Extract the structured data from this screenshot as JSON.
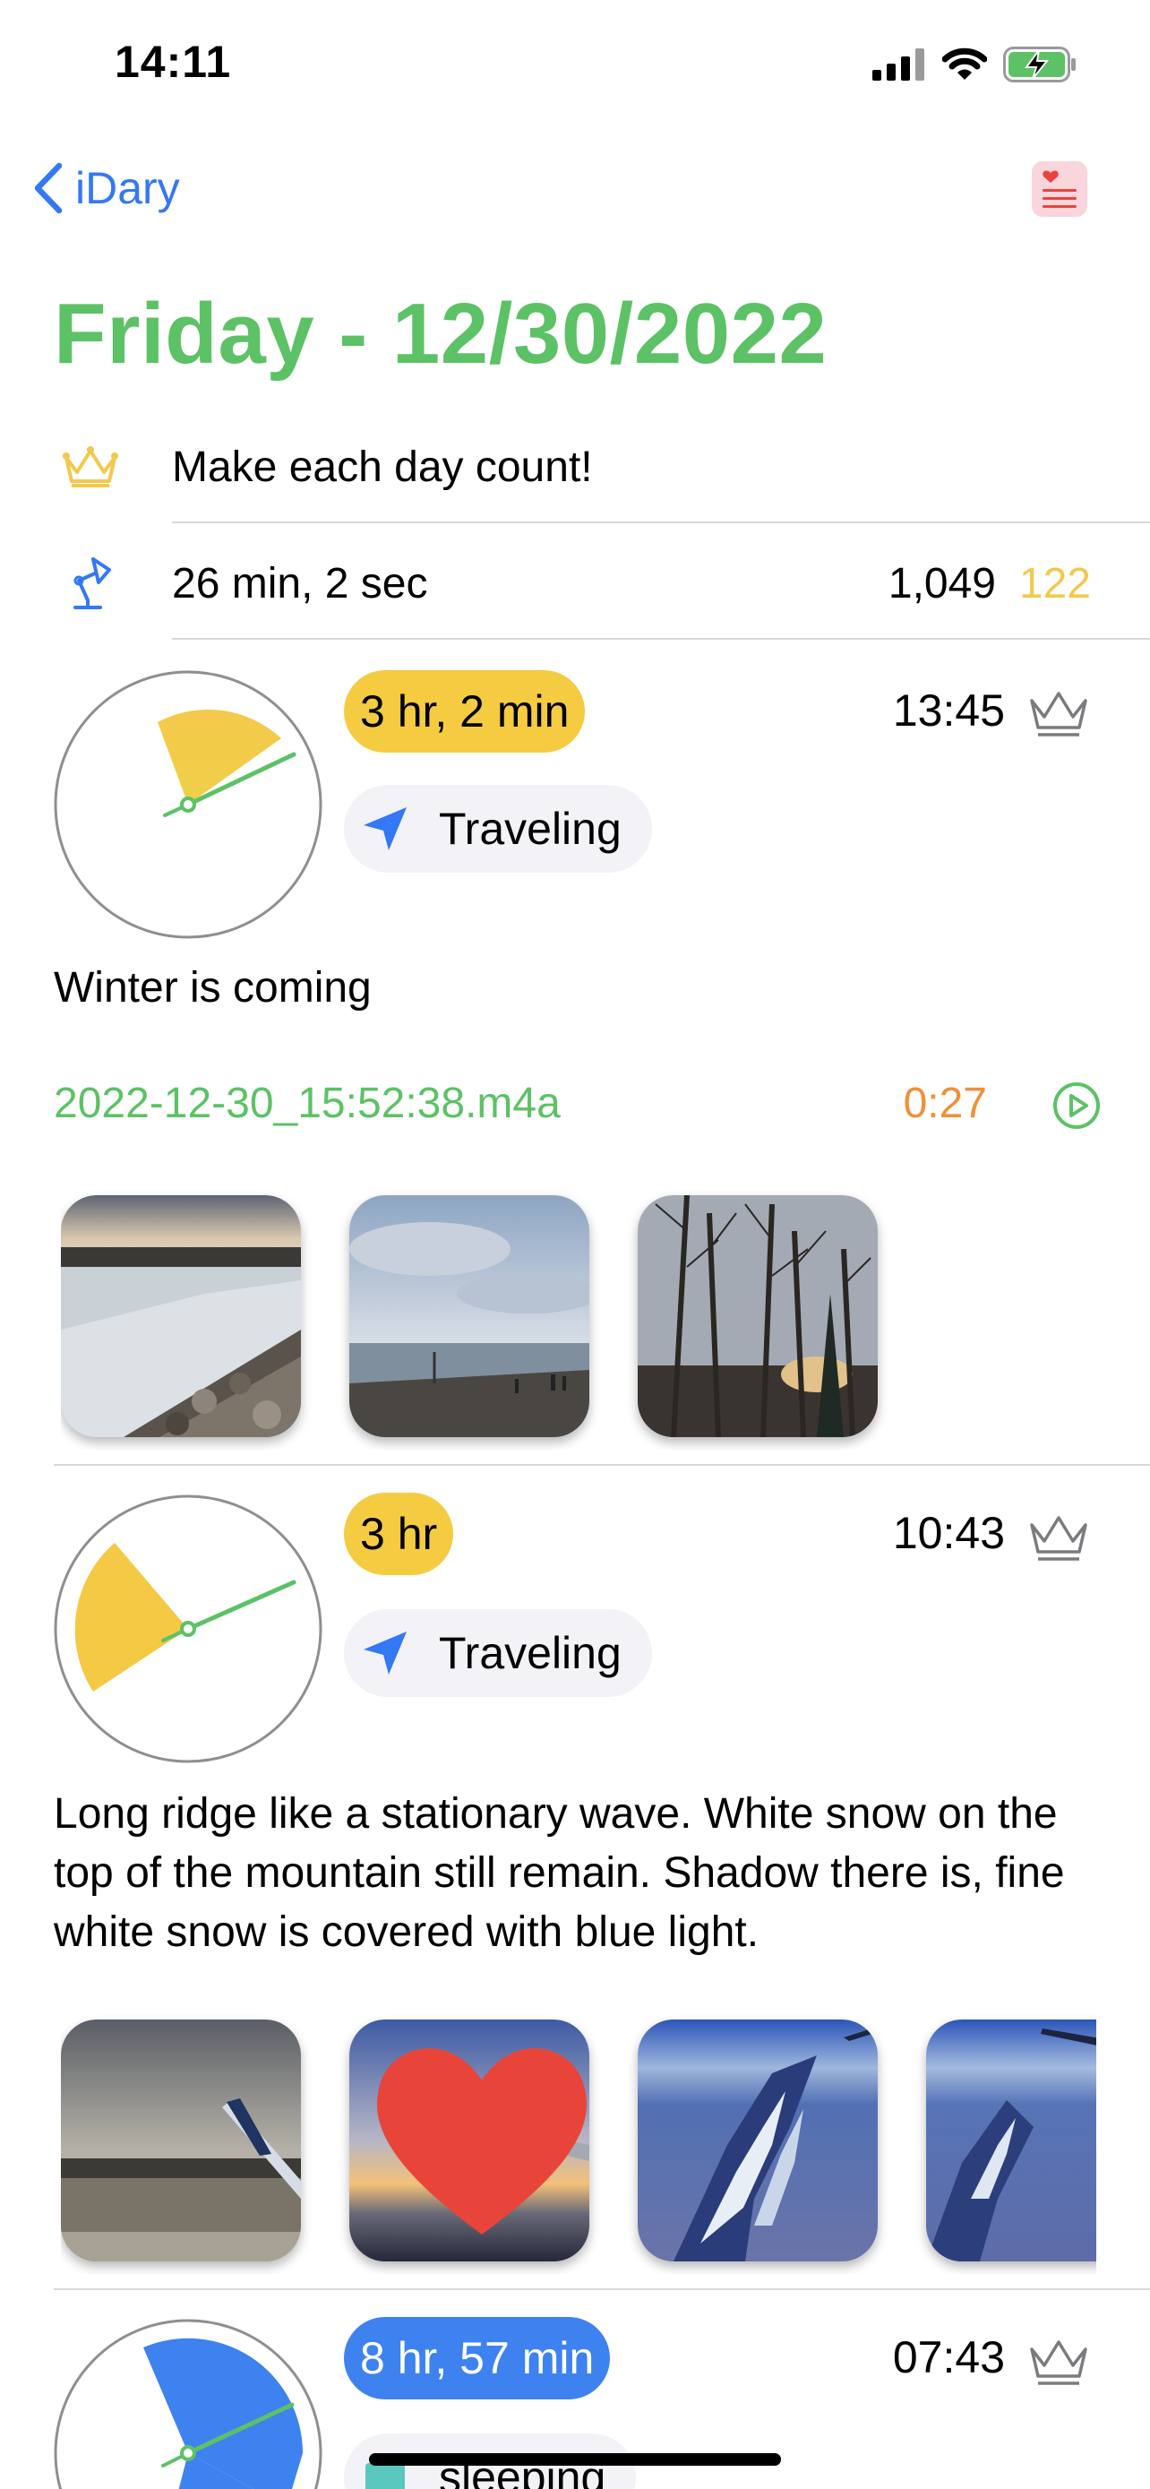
{
  "status_bar": {
    "time": "14:11"
  },
  "nav": {
    "back_label": "iDary"
  },
  "title": "Friday - 12/30/2022",
  "quote": "Make each day count!",
  "stats": {
    "writing_time": "26 min, 2 sec",
    "word_count": "1,049",
    "streak": "122"
  },
  "entries": [
    {
      "duration": "3 hr, 2 min",
      "time": "13:45",
      "activity": "Traveling",
      "text": "Winter is coming",
      "audio": {
        "file": "2022-12-30_15:52:38.m4a",
        "length": "0:27"
      },
      "photos": [
        "frozen-shore-photo",
        "beach-overcast-photo",
        "bare-trees-sunset-photo"
      ]
    },
    {
      "duration": "3 hr",
      "time": "10:43",
      "activity": "Traveling",
      "text": "Long ridge like a stationary wave. White snow on the top of the mountain still remain. Shadow there is, fine white snow is covered with blue light.",
      "photos": [
        "airplane-wing-runway-photo",
        "airplane-wing-sunset-photo",
        "snowy-mountains-aerial-photo",
        "mountains-wingtip-photo"
      ],
      "favorite_photo_index": 1
    },
    {
      "duration": "8 hr, 57 min",
      "time": "07:43",
      "activity": "sleeping"
    }
  ],
  "colors": {
    "accent_green": "#5cc265",
    "link_blue": "#3478f6",
    "pill_yellow": "#f5cb42",
    "pill_blue": "#3e82f0",
    "audio_orange": "#f0903a",
    "heart_red": "#e9443a"
  }
}
